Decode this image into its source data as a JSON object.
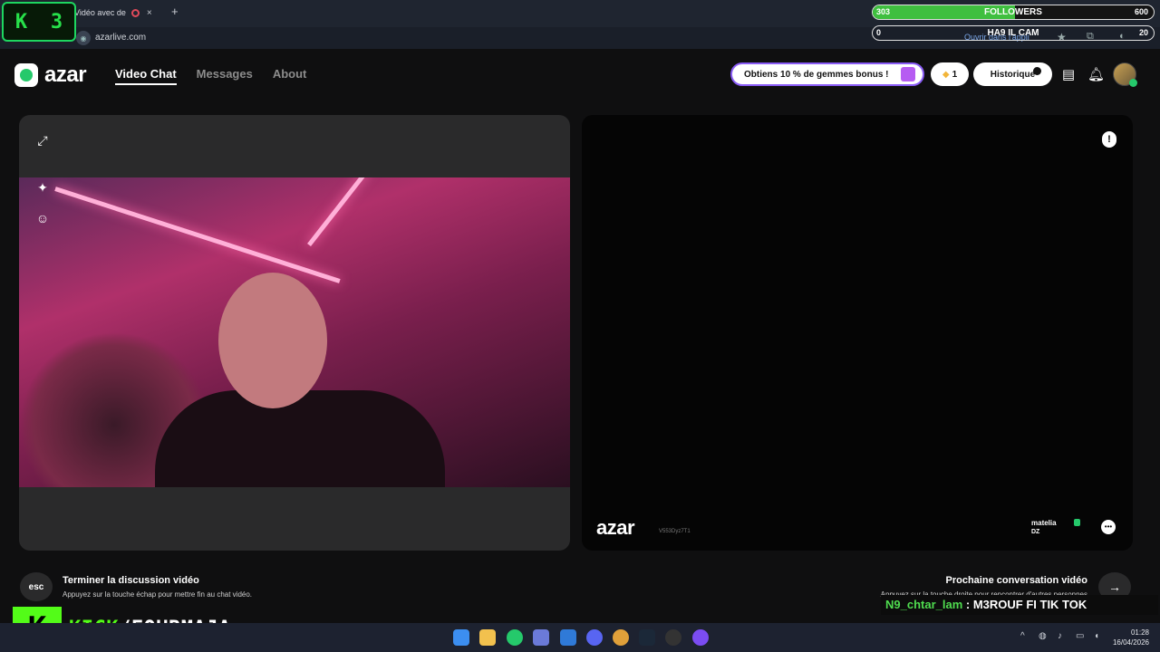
{
  "browser": {
    "tab_title": "Vidéo avec de",
    "tab_close": "×",
    "new_tab": "+",
    "url": "azarlive.com",
    "open_in_app": "Ouvrir dans l'appli"
  },
  "stream_overlay": {
    "kick_badge_letter": "K",
    "kick_badge_count": "3",
    "followers_bar": {
      "label": "FOLLOWERS",
      "current": "303",
      "goal": "600",
      "progress_fraction": 0.505
    },
    "second_bar": {
      "label": "HA9 IL CAM",
      "current": "0",
      "goal": "20"
    },
    "chat": {
      "user": "N9_chtar_lam",
      "separator": " : ",
      "message": "M3ROUF FI TIK TOK"
    },
    "kick_channel": {
      "logo_letter": "K",
      "kick_text": "KICK",
      "channel": "/FOURMAJA"
    }
  },
  "header": {
    "logo_text": "azar",
    "nav": [
      {
        "label": "Video Chat",
        "active": true
      },
      {
        "label": "Messages",
        "active": false
      },
      {
        "label": "About",
        "active": false
      }
    ],
    "promo_label": "Obtiens 10 % de gemmes bonus !",
    "gems_count": "1",
    "history_label": "Historique"
  },
  "left_panel": {
    "icons": [
      "expand-icon",
      "magic-wand-icon",
      "sticker-icon"
    ]
  },
  "right_panel": {
    "watermark_logo": "azar",
    "watermark_id": "V553Dyz7T1",
    "partner_name": "matelia",
    "partner_country": "DZ"
  },
  "footer": {
    "esc_label": "esc",
    "end_title": "Terminer la discussion vidéo",
    "end_desc": "Appuyez sur la touche échap pour mettre fin au chat vidéo.",
    "next_title": "Prochaine conversation vidéo",
    "next_desc": "Appuyez sur la touche droite pour rencontrer d'autres personnes",
    "next_arrow": "→"
  },
  "taskbar": {
    "time": "01:28",
    "date": "16/04/2026",
    "tray_chevron": "^"
  },
  "colors": {
    "azar_green": "#25c96b",
    "kick_green": "#53fc18",
    "promo_border": "#8a5cf6"
  }
}
